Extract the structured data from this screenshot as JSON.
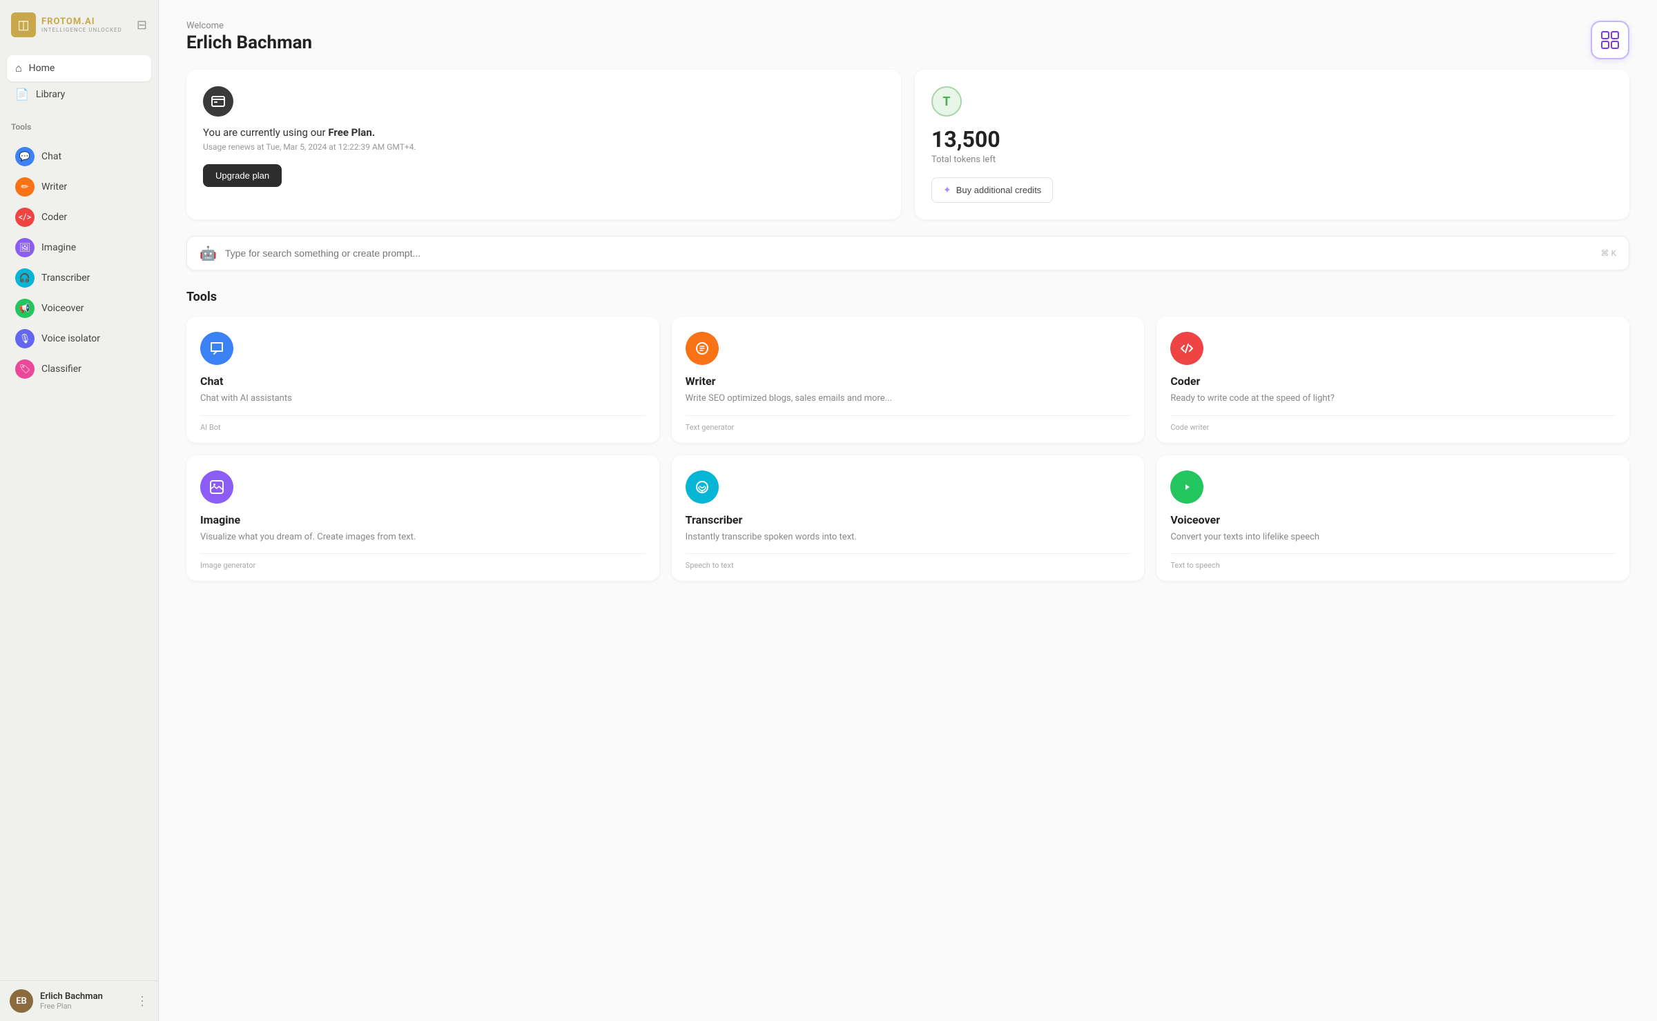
{
  "logo": {
    "icon": "◫",
    "text": "FROTOM.AI",
    "subtitle": "INTELLIGENCE UNLOCKED"
  },
  "nav": {
    "items": [
      {
        "id": "home",
        "label": "Home",
        "icon": "⌂",
        "active": true
      },
      {
        "id": "library",
        "label": "Library",
        "icon": "☰",
        "active": false
      }
    ]
  },
  "tools_section_label": "Tools",
  "tools_nav": [
    {
      "id": "chat",
      "label": "Chat",
      "color": "#3b82f6"
    },
    {
      "id": "writer",
      "label": "Writer",
      "color": "#f97316"
    },
    {
      "id": "coder",
      "label": "Coder",
      "color": "#ef4444"
    },
    {
      "id": "imagine",
      "label": "Imagine",
      "color": "#8b5cf6"
    },
    {
      "id": "transcriber",
      "label": "Transcriber",
      "color": "#06b6d4"
    },
    {
      "id": "voiceover",
      "label": "Voiceover",
      "color": "#22c55e"
    },
    {
      "id": "voice-isolator",
      "label": "Voice isolator",
      "color": "#6366f1"
    },
    {
      "id": "classifier",
      "label": "Classifier",
      "color": "#ec4899"
    }
  ],
  "user": {
    "name": "Erlich Bachman",
    "plan": "Free Plan",
    "avatar_initials": "EB"
  },
  "welcome": {
    "greeting": "Welcome",
    "name": "Erlich Bachman"
  },
  "plan_card": {
    "plan_text_prefix": "You are currently using our ",
    "plan_name": "Free Plan.",
    "renewal": "Usage renews at Tue, Mar 5, 2024 at 12:22:39 AM GMT+4.",
    "upgrade_label": "Upgrade plan"
  },
  "tokens_card": {
    "token_icon": "T",
    "tokens": "13,500",
    "label": "Total tokens left",
    "buy_label": "Buy additional credits"
  },
  "search": {
    "placeholder": "Type for search something or create prompt...",
    "shortcut": "⌘ K"
  },
  "tools_heading": "Tools",
  "tool_cards": [
    {
      "id": "chat",
      "name": "Chat",
      "description": "Chat with AI assistants",
      "tag": "AI Bot",
      "color": "#3b82f6",
      "icon": "💬"
    },
    {
      "id": "writer",
      "name": "Writer",
      "description": "Write SEO optimized blogs, sales emails and more...",
      "tag": "Text generator",
      "color": "#f97316",
      "icon": "✏️"
    },
    {
      "id": "coder",
      "name": "Coder",
      "description": "Ready to write code at the speed of light?",
      "tag": "Code writer",
      "color": "#ef4444",
      "icon": "</>"
    },
    {
      "id": "imagine",
      "name": "Imagine",
      "description": "Visualize what you dream of. Create images from text.",
      "tag": "Image generator",
      "color": "#8b5cf6",
      "icon": "🖼"
    },
    {
      "id": "transcriber",
      "name": "Transcriber",
      "description": "Instantly transcribe spoken words into text.",
      "tag": "Speech to text",
      "color": "#06b6d4",
      "icon": "🎧"
    },
    {
      "id": "voiceover",
      "name": "Voiceover",
      "description": "Convert your texts into lifelike speech",
      "tag": "Text to speech",
      "color": "#22c55e",
      "icon": "📢"
    }
  ]
}
